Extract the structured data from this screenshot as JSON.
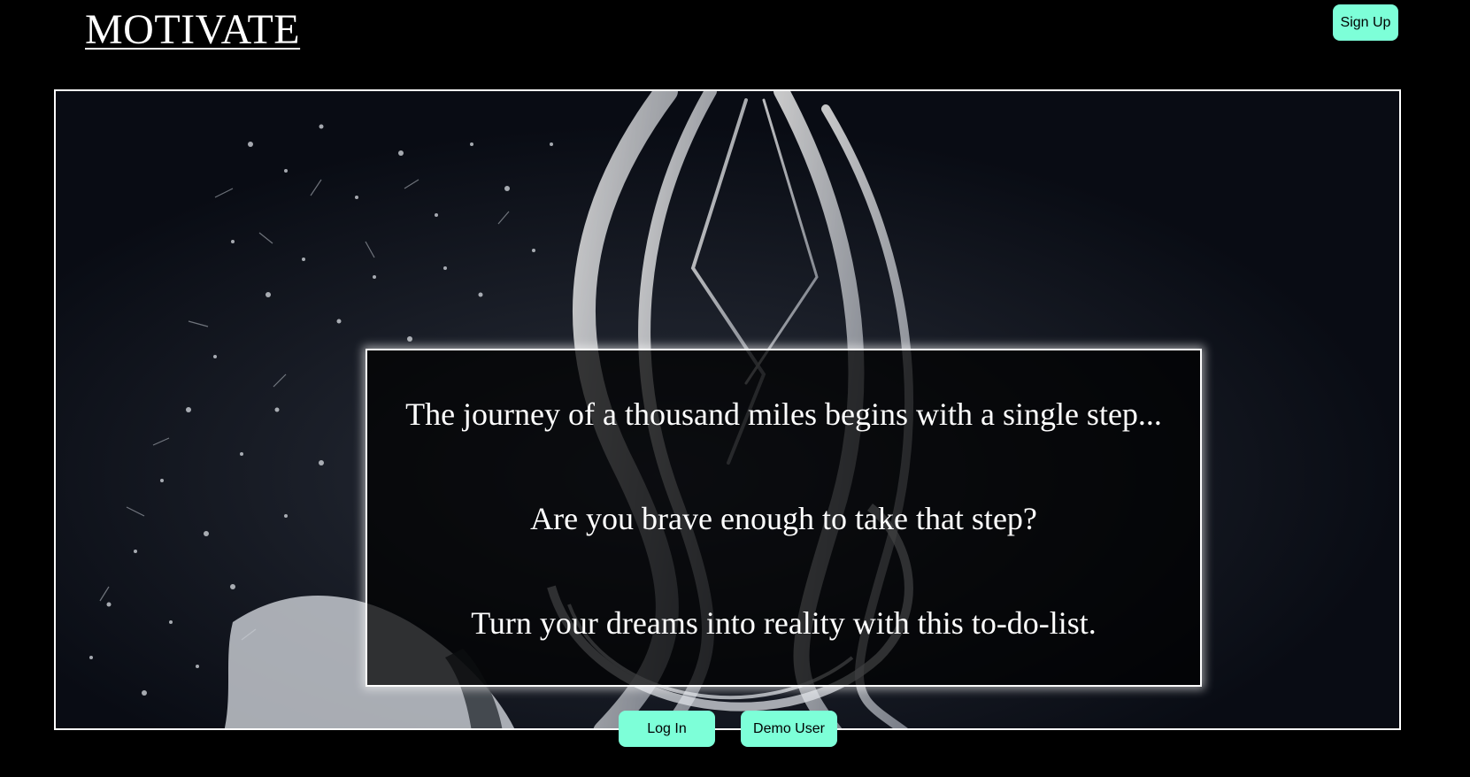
{
  "header": {
    "brand": "MOTIVATE",
    "signup_label": "Sign Up"
  },
  "hero": {
    "lines": [
      "The journey of a thousand miles begins with a single step...",
      "Are you brave enough to take that step?",
      "Turn your dreams into reality with this to-do-list."
    ]
  },
  "actions": {
    "login_label": "Log In",
    "demo_label": "Demo User"
  },
  "colors": {
    "background": "#000000",
    "button": "#7dffd8",
    "text": "#ffffff"
  }
}
